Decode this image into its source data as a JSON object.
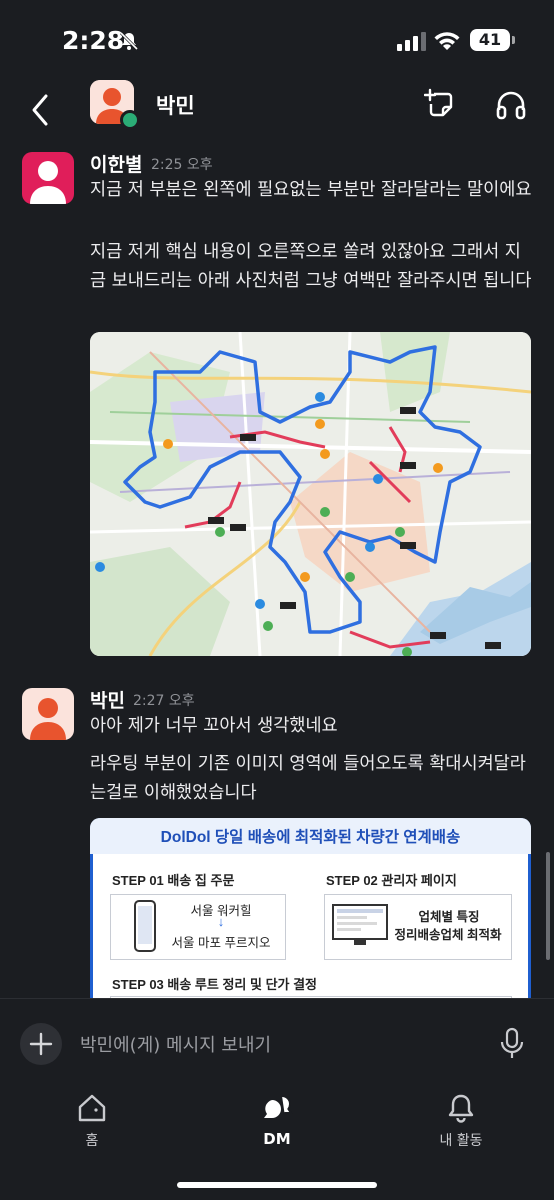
{
  "status_bar": {
    "time": "2:28",
    "battery": "41"
  },
  "header": {
    "title": "박민"
  },
  "messages": [
    {
      "sender": "이한별",
      "time": "2:25 오후",
      "paragraphs": [
        "지금 저 부분은 왼쪽에 필요없는 부분만 잘라달라는 말이에요",
        "지금 저게 핵심 내용이 오른쪽으로 쏠려 있잖아요 그래서 지금 보내드리는 아래 사진처럼 그냥 여백만 잘라주시면 됩니다"
      ]
    },
    {
      "sender": "박민",
      "time": "2:27 오후",
      "paragraphs": [
        "아아 제가 너무 꼬아서 생각했네요",
        "라우팅 부분이 기존 이미지 영역에 들어오도록 확대시켜달라는걸로 이해했었습니다"
      ],
      "image": {
        "title": "DolDol 당일 배송에 최적화된 차량간 연계배송",
        "step1": "STEP 01 배송 집 주문",
        "step1_from": "서울 워커힐",
        "step1_arrow": "↓",
        "step1_to": "서울 마포 푸르지오",
        "step2": "STEP 02 관리자 페이지",
        "step2_line1": "업체별 특징",
        "step2_line2": "정리배송업체 최적화",
        "step3": "STEP 03 배송 루트 정리 및 단가 결정"
      }
    }
  ],
  "composer": {
    "placeholder": "박민에(게) 메시지 보내기"
  },
  "tabs": [
    {
      "label": "홈",
      "icon": "home-icon"
    },
    {
      "label": "DM",
      "icon": "dm-icon"
    },
    {
      "label": "내 활동",
      "icon": "bell-icon"
    }
  ],
  "colors": {
    "background": "#1b1d21",
    "presence": "#2bac76",
    "avatar_pink": "#e01e5a",
    "avatar_orange": "#e8542e"
  }
}
